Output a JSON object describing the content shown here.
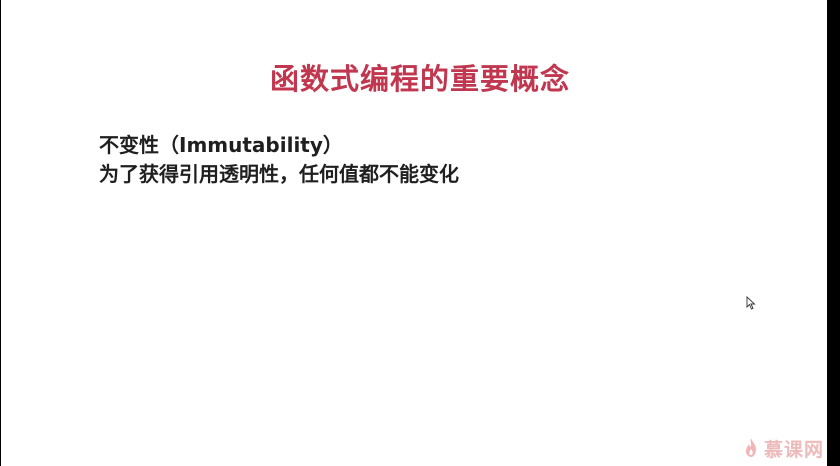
{
  "slide": {
    "title": "函数式编程的重要概念",
    "lines": [
      "不变性（Immutability）",
      "为了获得引用透明性，任何值都不能变化"
    ]
  },
  "watermark": {
    "text": "慕课网",
    "icon": "flame-icon"
  },
  "colors": {
    "title": "#c0374f",
    "text": "#1f1f1f",
    "background": "#ffffff",
    "letterbox": "#000000"
  }
}
